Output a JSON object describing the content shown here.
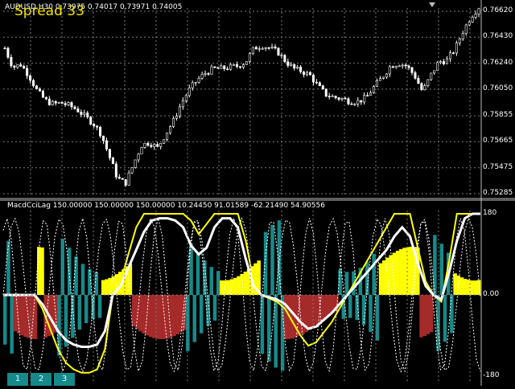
{
  "chart_header": {
    "text": "AUDUSD,H30  0.73975 0.74017 0.73971 0.74005",
    "spread_label": "Spread 33"
  },
  "indicator_header": {
    "text": "MacdCciLag 150.00000 150.00000 150.00000 10.24450 91.01589 -62.21490 54.90556"
  },
  "buttons": [
    "1",
    "2",
    "3"
  ],
  "colors": {
    "background": "#000000",
    "grid": "#7a7a7a",
    "text": "#ffffff",
    "spread": "#f5e400",
    "teal": "#168a8a",
    "yellow": "#ffff00",
    "red": "#a52a2a"
  },
  "chart_data": [
    {
      "type": "candlestick",
      "symbol": "AUDUSD",
      "timeframe": "H30",
      "ohlc_current": {
        "open": 0.73975,
        "high": 0.74017,
        "low": 0.73971,
        "close": 0.74005
      },
      "ylim": [
        0.75285,
        0.7662
      ],
      "y_ticks": [
        "0.76620",
        "0.76430",
        "0.76240",
        "0.76050",
        "0.75855",
        "0.75665",
        "0.75475",
        "0.75285"
      ],
      "price_path": [
        0.7635,
        0.7621,
        0.7623,
        0.7615,
        0.7604,
        0.7597,
        0.7594,
        0.7595,
        0.7593,
        0.759,
        0.7585,
        0.758,
        0.7572,
        0.7556,
        0.754,
        0.7536,
        0.755,
        0.7564,
        0.7566,
        0.7562,
        0.7572,
        0.7582,
        0.7595,
        0.7605,
        0.7612,
        0.7617,
        0.762,
        0.762,
        0.7621,
        0.7622,
        0.7625,
        0.7635,
        0.7637,
        0.7635,
        0.7632,
        0.7625,
        0.762,
        0.7618,
        0.7615,
        0.7607,
        0.7601,
        0.7599,
        0.7598,
        0.7596,
        0.7596,
        0.7599,
        0.7607,
        0.7614,
        0.7622,
        0.7624,
        0.7622,
        0.7615,
        0.7603,
        0.7615,
        0.7625,
        0.7626,
        0.7634,
        0.7647,
        0.7658,
        0.7665
      ]
    },
    {
      "type": "line",
      "name": "MacdCciLag",
      "ylim": [
        -180,
        180
      ],
      "y_ticks": [
        "180",
        "0.00",
        "-180"
      ],
      "histogram_states": [
        "teal",
        "teal",
        "teal",
        "red",
        "red",
        "red",
        "red",
        "red",
        "red",
        "red",
        "yellow",
        "yellow",
        "red",
        "red",
        "red",
        "red",
        "teal",
        "teal",
        "teal",
        "teal",
        "teal",
        "teal",
        "teal",
        "teal",
        "teal",
        "teal",
        "teal",
        "teal",
        "teal",
        "yellow",
        "yellow",
        "yellow",
        "yellow",
        "yellow",
        "yellow",
        "yellow",
        "yellow",
        "yellow",
        "red",
        "red",
        "red",
        "red",
        "red",
        "red",
        "red",
        "red",
        "red",
        "red",
        "red",
        "red",
        "red",
        "red",
        "red",
        "red",
        "teal",
        "teal",
        "teal",
        "teal",
        "teal",
        "teal",
        "teal",
        "teal",
        "teal",
        "teal",
        "yellow",
        "yellow",
        "yellow",
        "yellow",
        "yellow",
        "yellow",
        "yellow",
        "yellow",
        "yellow",
        "yellow",
        "yellow",
        "yellow",
        "teal",
        "teal",
        "teal",
        "teal",
        "teal",
        "teal",
        "teal",
        "red",
        "red",
        "red",
        "red",
        "red",
        "red",
        "red",
        "red",
        "red",
        "red",
        "red",
        "red",
        "red",
        "red",
        "red",
        "red",
        "teal",
        "teal",
        "teal",
        "teal",
        "teal",
        "teal",
        "teal",
        "teal",
        "teal",
        "teal",
        "teal",
        "teal",
        "yellow",
        "yellow",
        "yellow",
        "yellow",
        "yellow",
        "yellow",
        "yellow",
        "yellow",
        "yellow",
        "yellow",
        "yellow",
        "yellow",
        "red",
        "red",
        "red",
        "red",
        "teal",
        "teal",
        "teal",
        "teal",
        "teal",
        "teal",
        "yellow",
        "yellow",
        "yellow",
        "yellow",
        "yellow",
        "yellow",
        "yellow",
        "yellow"
      ],
      "line_path": [
        0,
        0,
        0,
        0,
        0,
        -20,
        -50,
        -80,
        -100,
        -110,
        -115,
        -115,
        -110,
        -80,
        0,
        20,
        60,
        100,
        140,
        165,
        170,
        170,
        165,
        150,
        110,
        90,
        105,
        150,
        170,
        170,
        150,
        80,
        20,
        0,
        -5,
        -10,
        -20,
        -40,
        -60,
        -75,
        -70,
        -55,
        -40,
        -20,
        0,
        20,
        40,
        60,
        80,
        100,
        130,
        150,
        130,
        70,
        20,
        0,
        -10,
        50,
        120,
        170,
        180,
        180
      ]
    }
  ]
}
